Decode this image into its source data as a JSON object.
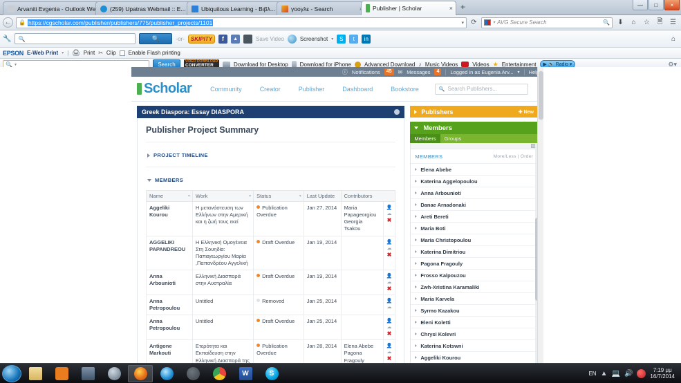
{
  "browser": {
    "tabs": [
      {
        "label": "Arvaniti Evgenia - Outlook We...",
        "favicon": "page-icon",
        "color": "#c8cdd3",
        "active": false,
        "close": "×"
      },
      {
        "label": "(259) Upatras Webmail :: E...",
        "favicon": "mail-icon",
        "color": "#1e8fd5",
        "active": false,
        "close": "×"
      },
      {
        "label": "Ubiquitous Learning - Βιβλ...",
        "favicon": "blue-square-icon",
        "color": "#2d7fd8",
        "active": false,
        "close": "×"
      },
      {
        "label": "γοογλε - Search",
        "favicon": "google-icon",
        "color": "#e8b020",
        "active": false,
        "close": "×"
      },
      {
        "label": "Publisher | Scholar",
        "favicon": "scholar-icon",
        "color": "#4caf50",
        "active": true,
        "close": "×"
      }
    ],
    "new_tab_label": "+",
    "window_controls": {
      "minimize": "—",
      "maximize": "□",
      "close": "×"
    },
    "back_label": "←",
    "url": "https://cgscholar.com/publisher/publishers/775/publisher_projects/1101",
    "lock_icon": "lock-icon",
    "reload_label": "⟳",
    "search_placeholder": "AVG Secure Search",
    "nav_icons": [
      "download-icon",
      "home-icon",
      "star-icon",
      "reader-icon",
      "menu-icon"
    ]
  },
  "addon_bar_1": {
    "search_placeholder": "",
    "go_label": "",
    "or_label": "-or-",
    "skipity_label": "SKIPITY",
    "facebook_label": "f",
    "like_label": "👍",
    "save_video_label": "Save Video",
    "screenshot_label": "Screenshot",
    "screenshot_caret": "▾",
    "social_icons": [
      "skype-icon",
      "twitter-icon",
      "linkedin-icon"
    ],
    "home_icon": "home-icon"
  },
  "addon_bar_2": {
    "brand": "EPSON",
    "product": "E-Web Print",
    "caret": "▾",
    "print_label": "Print",
    "clip_label": "Clip",
    "flash_label": "Enable Flash printing"
  },
  "addon_bar_3": {
    "search_value": "",
    "search_button": "Search",
    "converter_line1": "VIDEO DOWNLOAD",
    "converter_line2": "CONVERTER",
    "items": [
      "Download for Desktop",
      "Download for iPhone",
      "Advanced Download",
      "Music Videos",
      "Videos",
      "Entertainment"
    ],
    "radio_label": "Radio",
    "radio_caret": "▾"
  },
  "scholar": {
    "utility": {
      "notifications_label": "Notifications",
      "notifications_count": "45",
      "messages_label": "Messages",
      "messages_count": "4",
      "account_label": "Logged in as Eugenia Arv...",
      "account_caret": "▾",
      "help_label": "Help"
    },
    "brand": "Scholar",
    "nav": [
      "Community",
      "Creator",
      "Publisher",
      "Dashboard",
      "Bookstore"
    ],
    "search_placeholder": "Search Publishers...",
    "search_icon": "search-icon"
  },
  "project": {
    "title": "Greek Diaspora: Essay DIASPORA",
    "gear_icon": "gear-icon",
    "summary_heading": "Publisher Project Summary",
    "sections": [
      {
        "label": "PROJECT TIMELINE",
        "expanded": false
      },
      {
        "label": "MEMBERS",
        "expanded": true
      }
    ]
  },
  "members_table": {
    "columns": [
      "Name",
      "Work",
      "Status",
      "Last Update",
      "Contributors"
    ],
    "rows": [
      {
        "name": "Aggeliki Kourou",
        "work": "Η μετανάστευση των Ελλήνων στην Αμερική και η ζωή τους εκεί",
        "status": "Publication Overdue",
        "status_color": "orange",
        "last_update": "Jan 27, 2014",
        "contributors": "Maria Papageorgiou Georgia Tsakou",
        "actions": [
          "person-icon",
          "cloud-icon",
          "delete-icon"
        ]
      },
      {
        "name": "AGGELIKI PAPANDREOU",
        "work": "Η Ελληνική Ομογένεια Στη Σουηδία: Παπαγεωργίου Μαρία ,Παπανδρέου Αγγελική",
        "status": "Draft Overdue",
        "status_color": "orange",
        "last_update": "Jan 19, 2014",
        "contributors": "",
        "actions": [
          "person-icon",
          "cloud-icon",
          "delete-icon"
        ]
      },
      {
        "name": "Anna Arbounioti",
        "work": "Ελληνική Διασπορά στην Αυστραλία",
        "status": "Draft Overdue",
        "status_color": "orange",
        "last_update": "Jan 19, 2014",
        "contributors": "",
        "actions": [
          "person-icon",
          "cloud-icon",
          "delete-icon"
        ]
      },
      {
        "name": "Anna Petropoulou",
        "work": "Untitled",
        "status": "Removed",
        "status_color": "grey",
        "last_update": "Jan 25, 2014",
        "contributors": "",
        "actions": [
          "person-icon",
          "cloud-icon"
        ]
      },
      {
        "name": "Anna Petropoulou",
        "work": "Untitled",
        "status": "Draft Overdue",
        "status_color": "orange",
        "last_update": "Jan 25, 2014",
        "contributors": "",
        "actions": [
          "person-icon",
          "cloud-icon",
          "delete-icon"
        ]
      },
      {
        "name": "Antigone Markouti",
        "work": "Ετερότητα και Εκπαίδευση στην Ελληνική Διασπορά της Γερμανίας",
        "status": "Publication Overdue",
        "status_color": "orange",
        "last_update": "Jan 28, 2014",
        "contributors": "Elena Abebe Pagona Fragouly",
        "actions": [
          "person-icon",
          "cloud-icon",
          "delete-icon"
        ]
      }
    ]
  },
  "sidebar": {
    "publishers": {
      "title": "Publishers",
      "new_label": "New",
      "new_icon": "plus-icon"
    },
    "members_panel": {
      "title": "Members",
      "tabs": [
        {
          "label": "Members",
          "active": true
        },
        {
          "label": "Groups",
          "active": false
        }
      ],
      "list_heading": "MEMBERS",
      "more_less_label": "More/Less",
      "order_label": "Order",
      "items": [
        "Elena Abebe",
        "Katerina Aggelopoulou",
        "Anna Arbounioti",
        "Danae Arnadonaki",
        "Areti Bereti",
        "Maria Boti",
        "Maria Christopoulou",
        "Katerina Dimitriou",
        "Pagona Fragouly",
        "Frosso Kalpouzou",
        "Zwh-Xristina Karamaliki",
        "Maria Karvela",
        "Syrmo Kazakou",
        "Eleni Koletti",
        "Chrysi Kolevri",
        "Katerina Kotswni",
        "Aggeliki Kourou"
      ]
    }
  },
  "taskbar": {
    "start_icon": "windows-start-icon",
    "items": [
      {
        "icon": "explorer-icon",
        "active": false
      },
      {
        "icon": "media-player-icon",
        "active": false
      },
      {
        "icon": "photo-viewer-icon",
        "active": false
      },
      {
        "icon": "antivirus-icon",
        "active": false
      },
      {
        "icon": "firefox-icon",
        "active": true
      },
      {
        "icon": "internet-explorer-icon",
        "active": false
      },
      {
        "icon": "app-icon",
        "active": false
      },
      {
        "icon": "chrome-icon",
        "active": false
      },
      {
        "icon": "word-icon",
        "active": false
      },
      {
        "icon": "skype-icon",
        "active": false
      }
    ],
    "language": "EN",
    "tray_icons": [
      "show-hidden-icon",
      "network-icon",
      "volume-icon",
      "antivirus-tray-icon"
    ],
    "time": "7:19 μμ",
    "date": "16/7/2014"
  },
  "colors": {
    "scholar_blue": "#2b8fc9",
    "project_header": "#1d3f72",
    "publishers_orange": "#efa91f",
    "members_green": "#57a21c",
    "status_orange": "#f0872c",
    "badge_orange": "#e8742a"
  }
}
